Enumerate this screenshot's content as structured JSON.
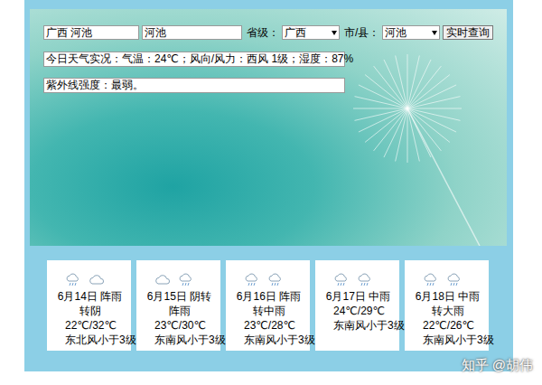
{
  "search": {
    "location_value": "广西 河池",
    "city_value": "河池",
    "province_label": "省级：",
    "province": "广西",
    "city_label": "市/县：",
    "city": "河池",
    "button": "实时查询"
  },
  "today": {
    "current": "今日天气实况：气温：24℃；风向/风力：西风 1级；湿度：87%",
    "uv": "紫外线强度：最弱。"
  },
  "forecast": [
    {
      "date_weather": "6月14日 阵雨转阴",
      "temp": "22℃/32℃",
      "wind": "东北风小于3级",
      "icons": [
        {
          "kind": "rain"
        },
        {
          "kind": "cloud"
        }
      ]
    },
    {
      "date_weather": "6月15日 阴转阵雨",
      "temp": "23℃/30℃",
      "wind": "东南风小于3级",
      "icons": [
        {
          "kind": "cloud"
        },
        {
          "kind": "rain"
        }
      ]
    },
    {
      "date_weather": "6月16日 阵雨转中雨",
      "temp": "23℃/28℃",
      "wind": "东南风小于3级",
      "icons": [
        {
          "kind": "rain"
        },
        {
          "kind": "rain"
        }
      ]
    },
    {
      "date_weather": "6月17日 中雨",
      "temp": "24℃/29℃",
      "wind": "东南风小于3级",
      "icons": [
        {
          "kind": "rain"
        },
        {
          "kind": "rain"
        }
      ]
    },
    {
      "date_weather": "6月18日 中雨转大雨",
      "temp": "22℃/26℃",
      "wind": "东南风小于3级",
      "icons": [
        {
          "kind": "rain"
        },
        {
          "kind": "rain"
        }
      ]
    }
  ],
  "watermark": "知乎 @胡伟"
}
